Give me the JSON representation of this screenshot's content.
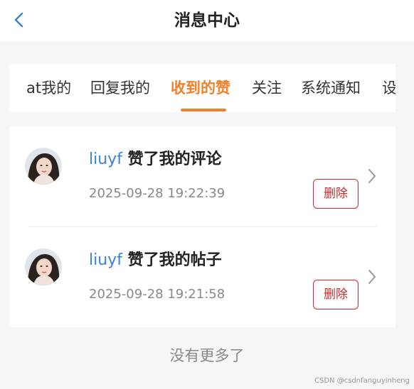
{
  "header": {
    "title": "消息中心",
    "back_icon": "chevron-left-icon"
  },
  "tabs": [
    {
      "label": "at我的",
      "active": false
    },
    {
      "label": "回复我的",
      "active": false
    },
    {
      "label": "收到的赞",
      "active": true
    },
    {
      "label": "关注",
      "active": false
    },
    {
      "label": "系统通知",
      "active": false
    },
    {
      "label": "设",
      "active": false
    }
  ],
  "messages": [
    {
      "user": "liuyf",
      "action": " 赞了我的评论",
      "time": "2025-09-28 19:22:39",
      "delete_label": "删除"
    },
    {
      "user": "liuyf",
      "action": " 赞了我的帖子",
      "time": "2025-09-28 19:21:58",
      "delete_label": "删除"
    }
  ],
  "footer": {
    "no_more": "没有更多了"
  },
  "watermark": "CSDN @csdnfanguyinheng",
  "colors": {
    "accent": "#f0812a",
    "link": "#3a82d8",
    "danger": "#cc2b2b"
  }
}
